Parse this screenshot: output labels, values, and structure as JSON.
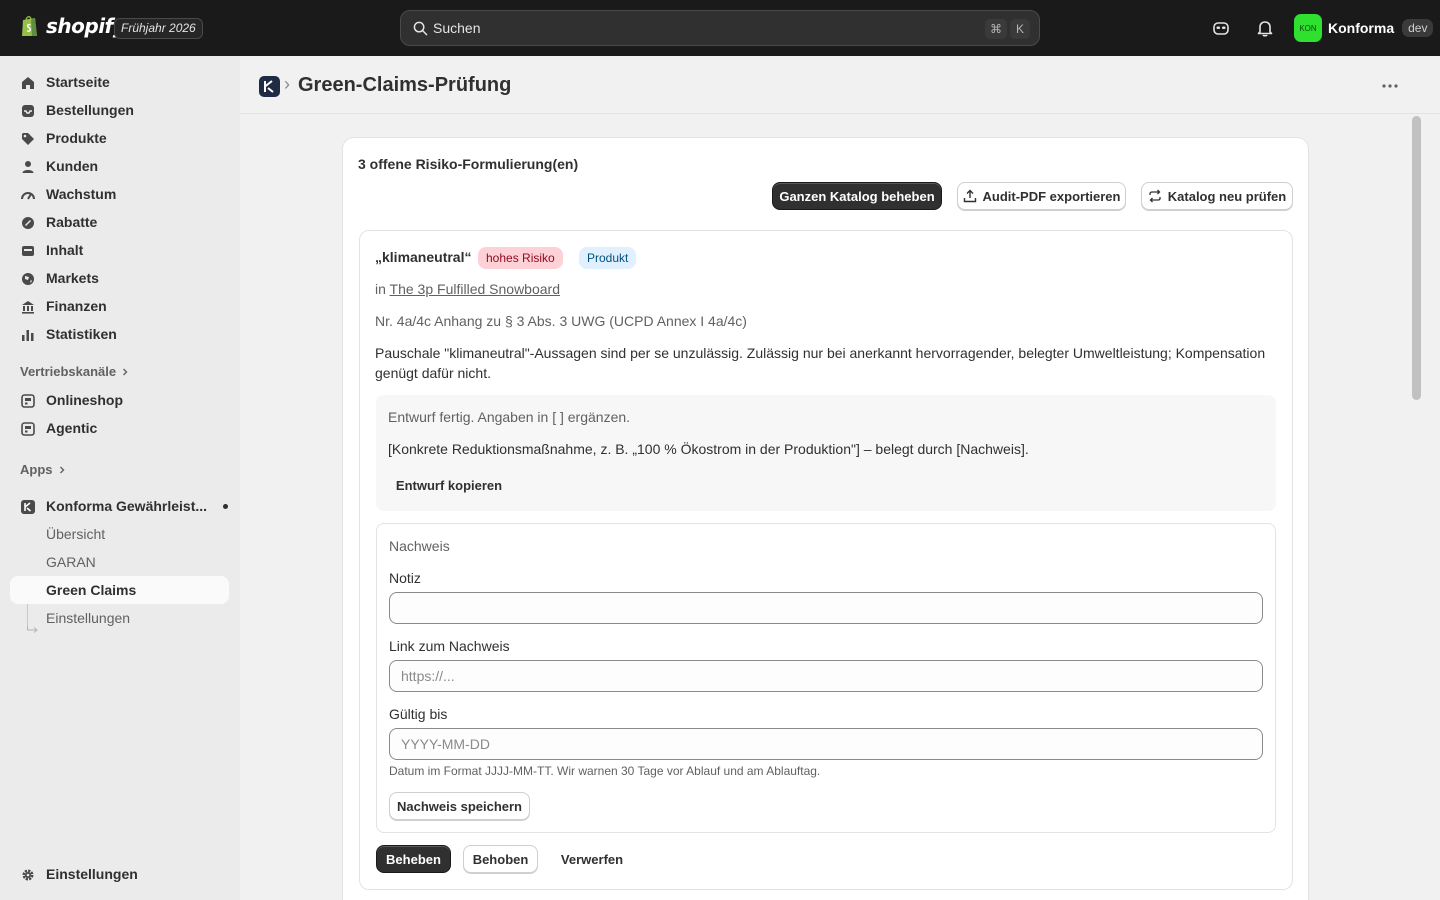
{
  "topbar": {
    "brand": "shopify",
    "edition": "Frühjahr 2026",
    "search_placeholder": "Suchen",
    "shortcut_cmd": "⌘",
    "shortcut_key": "K",
    "store_avatar": "KON",
    "store_name": "Konforma",
    "store_env": "dev"
  },
  "sidebar": {
    "items": [
      {
        "label": "Startseite",
        "icon": "home-icon"
      },
      {
        "label": "Bestellungen",
        "icon": "inbox-icon"
      },
      {
        "label": "Produkte",
        "icon": "tag-icon"
      },
      {
        "label": "Kunden",
        "icon": "person-icon"
      },
      {
        "label": "Wachstum",
        "icon": "gauge-icon"
      },
      {
        "label": "Rabatte",
        "icon": "discount-icon"
      },
      {
        "label": "Inhalt",
        "icon": "content-icon"
      },
      {
        "label": "Markets",
        "icon": "globe-icon"
      },
      {
        "label": "Finanzen",
        "icon": "bank-icon"
      },
      {
        "label": "Statistiken",
        "icon": "chart-icon"
      }
    ],
    "channels_heading": "Vertriebskanäle",
    "channels": [
      {
        "label": "Onlineshop",
        "icon": "store-icon"
      },
      {
        "label": "Agentic",
        "icon": "store-icon"
      }
    ],
    "apps_heading": "Apps",
    "app": {
      "label": "Konforma Gewährleist...",
      "subitems": [
        "Übersicht",
        "GARAN",
        "Green Claims",
        "Einstellungen"
      ],
      "active_subitem": "Green Claims"
    },
    "settings_label": "Einstellungen"
  },
  "page": {
    "title": "Green-Claims-Prüfung",
    "breadcrumb_separator": "›"
  },
  "card": {
    "title": "3 offene Risiko-Formulierung(en)",
    "actions": {
      "fix_all": "Ganzen Katalog beheben",
      "export": "Audit-PDF exportieren",
      "recheck": "Katalog neu prüfen"
    }
  },
  "claim": {
    "word": "„klimaneutral“",
    "risk_badge": "hohes Risiko",
    "type_badge": "Produkt",
    "in_prefix": "in",
    "product_link": "The 3p Fulfilled Snowboard",
    "legal_ref": "Nr. 4a/4c Anhang zu § 3 Abs. 3 UWG (UCPD Annex I 4a/4c)",
    "explanation": "Pauschale \"klimaneutral\"-Aussagen sind per se unzulässig. Zulässig nur bei anerkannt hervorragender, belegter Umweltleistung; Kompensation genügt dafür nicht.",
    "draft_status": "Entwurf fertig. Angaben in [ ] ergänzen.",
    "draft_text": "[Konkrete Reduktionsmaßnahme, z. B. „100 % Ökostrom in der Produktion\"] – belegt durch [Nachweis].",
    "copy_draft": "Entwurf kopieren",
    "evidence": {
      "title": "Nachweis",
      "note_label": "Notiz",
      "note_value": "",
      "link_label": "Link zum Nachweis",
      "link_placeholder": "https://...",
      "valid_label": "Gültig bis",
      "valid_placeholder": "YYYY-MM-DD",
      "help": "Datum im Format JJJJ-MM-TT. Wir warnen 30 Tage vor Ablauf und am Ablauftag.",
      "save": "Nachweis speichern"
    },
    "actions": {
      "fix": "Beheben",
      "fixed": "Behoben",
      "discard": "Verwerfen"
    }
  },
  "colors": {
    "topbar": "#1a1a1a",
    "sidebar": "#ebebeb",
    "background": "#f1f1f1",
    "primary_button": "#303030",
    "risk_badge_bg": "#fed1d7",
    "risk_badge_fg": "#8e0b21",
    "product_badge_bg": "#e0f0ff",
    "product_badge_fg": "#00527c",
    "store_avatar": "#2fe02f"
  }
}
